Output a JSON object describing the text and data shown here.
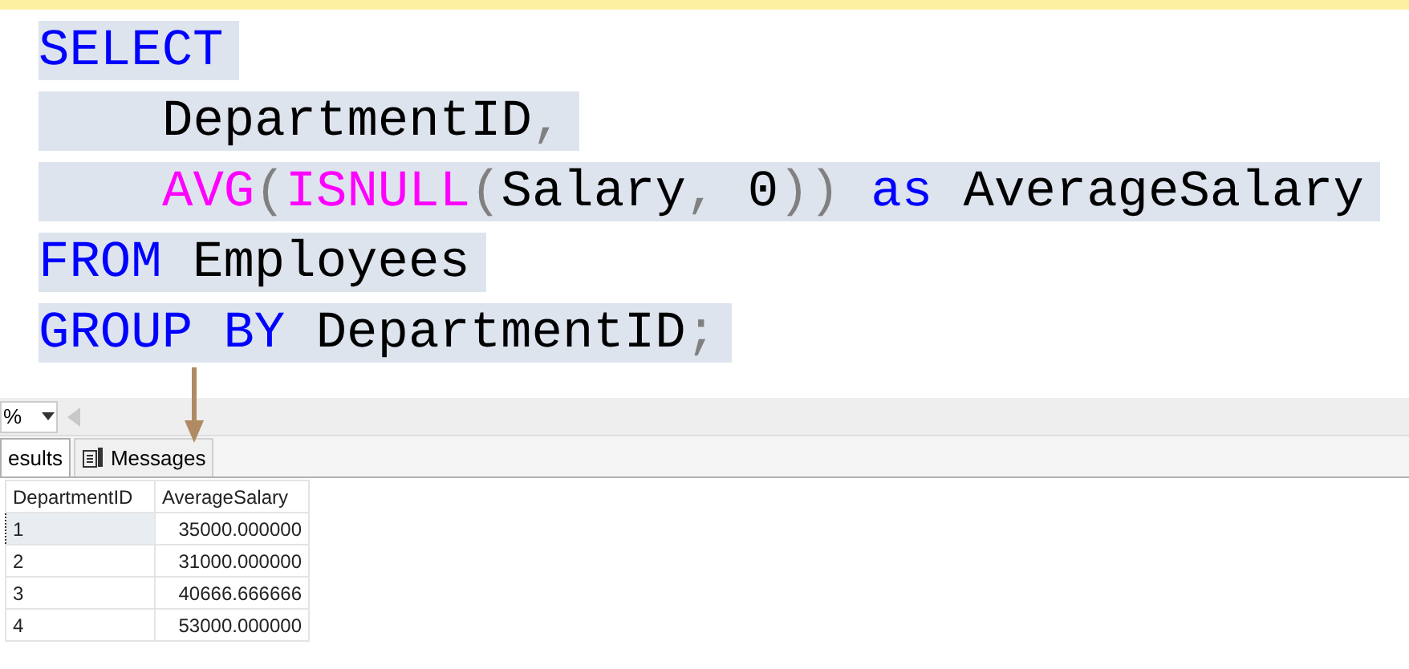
{
  "editor": {
    "lines": [
      {
        "tokens": [
          {
            "kind": "keyword",
            "text": "SELECT"
          }
        ]
      },
      {
        "indented": true,
        "tokens": [
          {
            "kind": "plain",
            "text": "DepartmentID"
          },
          {
            "kind": "punct",
            "text": ","
          }
        ]
      },
      {
        "indented": true,
        "tokens": [
          {
            "kind": "function",
            "text": "AVG"
          },
          {
            "kind": "punct",
            "text": "("
          },
          {
            "kind": "function",
            "text": "ISNULL"
          },
          {
            "kind": "punct",
            "text": "("
          },
          {
            "kind": "plain",
            "text": "Salary"
          },
          {
            "kind": "punct",
            "text": ","
          },
          {
            "kind": "plain",
            "text": " 0"
          },
          {
            "kind": "punct",
            "text": "))"
          },
          {
            "kind": "keyword",
            "text": " as"
          },
          {
            "kind": "plain",
            "text": " AverageSalary"
          }
        ]
      },
      {
        "tokens": [
          {
            "kind": "keyword",
            "text": "FROM"
          },
          {
            "kind": "plain",
            "text": " Employees"
          }
        ]
      },
      {
        "tokens": [
          {
            "kind": "keyword",
            "text": "GROUP BY"
          },
          {
            "kind": "plain",
            "text": " DepartmentID"
          },
          {
            "kind": "punct",
            "text": ";"
          }
        ]
      }
    ]
  },
  "zoom": {
    "value": "%"
  },
  "tabs": [
    {
      "label": "esults",
      "selected": true
    },
    {
      "label": "Messages",
      "selected": false
    }
  ],
  "grid": {
    "columns": [
      "DepartmentID",
      "AverageSalary"
    ],
    "rows": [
      {
        "cells": [
          "1",
          "35000.000000"
        ],
        "selected": true
      },
      {
        "cells": [
          "2",
          "31000.000000"
        ],
        "selected": false
      },
      {
        "cells": [
          "3",
          "40666.666666"
        ],
        "selected": false
      },
      {
        "cells": [
          "4",
          "53000.000000"
        ],
        "selected": false
      }
    ]
  }
}
